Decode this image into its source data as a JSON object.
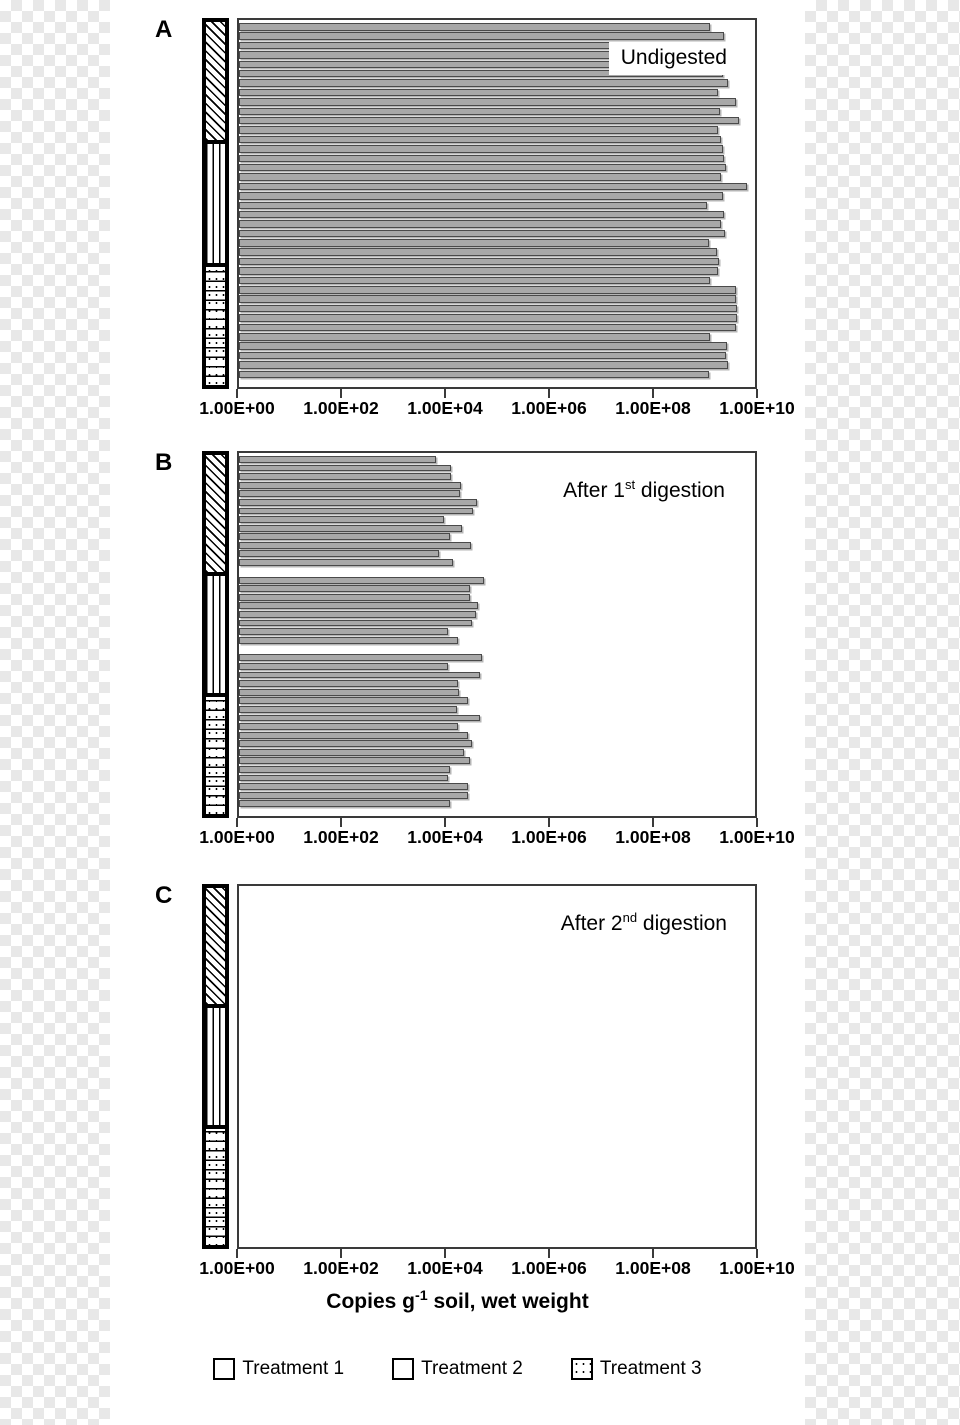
{
  "figure": {
    "x_axis_title": "Copies g-1 soil, wet weight",
    "x_axis_title_main": "Copies g",
    "x_axis_title_sup": "-1",
    "x_axis_title_rest": " soil, wet weight"
  },
  "panels": [
    {
      "letter": "A",
      "annotation_main": "Undigested",
      "annotation_sup": "",
      "annotation_rest": ""
    },
    {
      "letter": "B",
      "annotation_main": "After 1",
      "annotation_sup": "st",
      "annotation_rest": " digestion"
    },
    {
      "letter": "C",
      "annotation_main": "After 2",
      "annotation_sup": "nd",
      "annotation_rest": " digestion"
    }
  ],
  "axis": {
    "tick_labels": [
      "1.00E+00",
      "1.00E+02",
      "1.00E+04",
      "1.00E+06",
      "1.00E+08",
      "1.00E+10"
    ]
  },
  "legend": {
    "items": [
      {
        "label": "Treatment 1",
        "pattern": "diagonal-hatch"
      },
      {
        "label": "Treatment 2",
        "pattern": "vertical-lines"
      },
      {
        "label": "Treatment 3",
        "pattern": "dotted-stipple"
      }
    ]
  },
  "treatment_strips": [
    {
      "name": "Treatment 1",
      "pattern": "diagonal-hatch"
    },
    {
      "name": "Treatment 2",
      "pattern": "vertical-lines"
    },
    {
      "name": "Treatment 3",
      "pattern": "dotted-stipple"
    }
  ],
  "chart_data": {
    "type": "bar",
    "orientation": "horizontal",
    "title": "",
    "xlabel": "Copies g-1 soil, wet weight",
    "ylabel": "",
    "xscale": "log",
    "xlim": [
      1,
      10000000000
    ],
    "xticks": [
      1,
      100,
      10000,
      1000000,
      100000000,
      10000000000
    ],
    "xticklabels": [
      "1.00E+00",
      "1.00E+02",
      "1.00E+04",
      "1.00E+06",
      "1.00E+08",
      "1.00E+10"
    ],
    "grid": false,
    "legend_position": "bottom",
    "panels": [
      {
        "panel": "A",
        "annotation": "Undigested",
        "groups": [
          {
            "name": "Treatment 1",
            "values": [
              1600000000.0,
              3000000000.0,
              3200000000.0,
              3000000000.0,
              4600000000.0,
              2800000000.0,
              3600000000.0,
              2300000000.0,
              5100000000.0,
              2500000000.0,
              5800000000.0,
              2300000000.0
            ]
          },
          {
            "name": "Treatment 2",
            "values": [
              2600000000.0,
              2800000000.0,
              3000000000.0,
              3300000000.0,
              2600000000.0,
              8500000000.0,
              2800000000.0,
              1400000000.0,
              3000000000.0,
              2600000000.0,
              3100000000.0,
              1500000000.0
            ]
          },
          {
            "name": "Treatment 3",
            "values": [
              2200000000.0,
              2400000000.0,
              2300000000.0,
              1600000000.0,
              5000000000.0,
              5200000000.0,
              5400000000.0,
              5400000000.0,
              5200000000.0,
              1600000000.0,
              3400000000.0,
              3200000000.0,
              3500000000.0,
              1500000000.0
            ]
          }
        ]
      },
      {
        "panel": "B",
        "annotation": "After 1st digestion",
        "groups": [
          {
            "name": "Treatment 1",
            "values": [
              7000.0,
              14000.0,
              14000.0,
              22000.0,
              21000.0,
              44000.0,
              38000.0,
              10000.0,
              23000.0,
              13000.0,
              34000.0,
              8000.0,
              15000.0
            ]
          },
          {
            "name": "Treatment 2",
            "values": [
              60000.0,
              32000.0,
              32000.0,
              46000.0,
              42000.0,
              36000.0,
              12000.0,
              19000.0
            ]
          },
          {
            "name": "Treatment 3",
            "values": [
              56000.0,
              12000.0,
              50000.0,
              19000.0,
              20000.0,
              30000.0,
              18000.0,
              52000.0,
              19000.0,
              30000.0,
              36000.0,
              25000.0,
              33000.0,
              13000.0,
              12000.0,
              30000.0,
              30000.0,
              13000.0
            ]
          }
        ]
      },
      {
        "panel": "C",
        "annotation": "After 2nd digestion",
        "groups": [
          {
            "name": "Treatment 1",
            "values": []
          },
          {
            "name": "Treatment 2",
            "values": []
          },
          {
            "name": "Treatment 3",
            "values": []
          }
        ]
      }
    ]
  }
}
